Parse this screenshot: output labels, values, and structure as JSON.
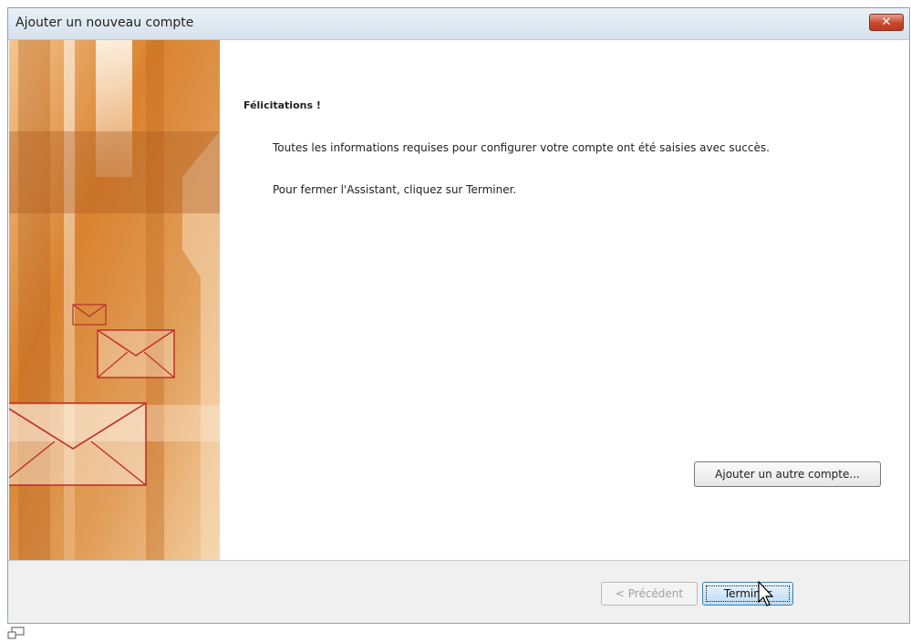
{
  "window": {
    "title": "Ajouter un nouveau compte",
    "close_icon": "close-icon"
  },
  "content": {
    "heading": "Félicitations !",
    "paragraph1": "Toutes les informations requises pour configurer votre compte ont été saisies avec succès.",
    "paragraph2": "Pour fermer l'Assistant, cliquez sur Terminer.",
    "add_account_label": "Ajouter un autre compte..."
  },
  "footer": {
    "previous_label": "< Précédent",
    "previous_enabled": false,
    "finish_label": "Terminer"
  },
  "colors": {
    "banner_primary": "#d98a3a",
    "banner_light": "#f6d3a8",
    "accent_blue": "#3c7fb1",
    "close_red": "#c9472d"
  }
}
